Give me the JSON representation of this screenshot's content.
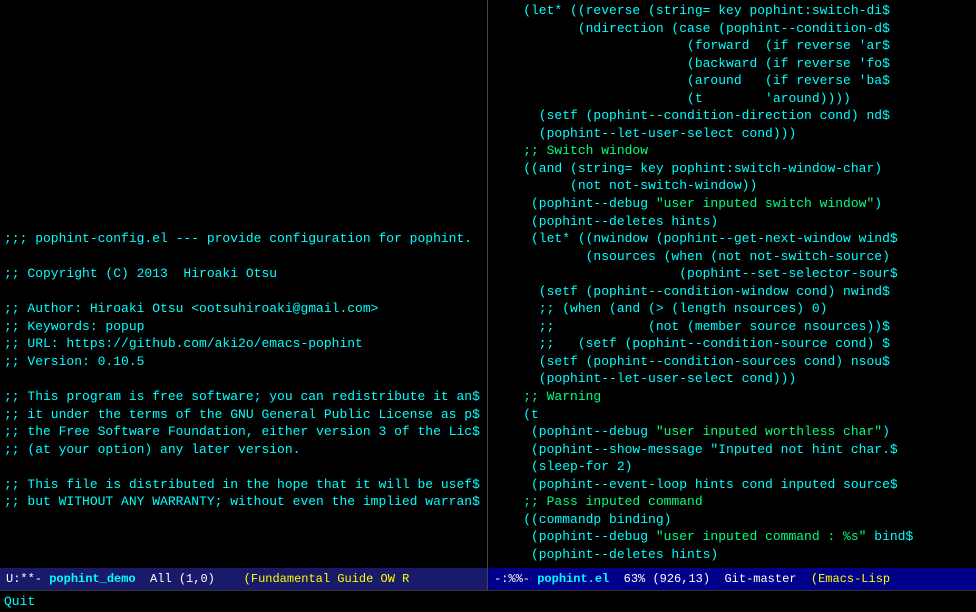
{
  "left_pane": {
    "content_lines": [
      "",
      "",
      "",
      "",
      "",
      "",
      "",
      "",
      "",
      "",
      "",
      "",
      "",
      ";;; pophint-config.el --- provide configuration for pophint.",
      "",
      ";; Copyright (C) 2013  Hiroaki Otsu",
      "",
      ";; Author: Hiroaki Otsu <ootsuhiroaki@gmail.com>",
      ";; Keywords: popup",
      ";; URL: https://github.com/aki2o/emacs-pophint",
      ";; Version: 0.10.5",
      "",
      ";; This program is free software; you can redistribute it an$",
      ";; it under the terms of the GNU General Public License as p$",
      ";; the Free Software Foundation, either version 3 of the Lic$",
      ";; (at your option) any later version.",
      "",
      ";; This file is distributed in the hope that it will be usef$",
      ";; but WITHOUT ANY WARRANTY; without even the implied warran$"
    ],
    "mode_line": {
      "flag": "U:**-",
      "filename": "pophint_demo",
      "position": "All (1,0)",
      "mode": "(Fundamental Guide OW R"
    }
  },
  "right_pane": {
    "content_lines": [
      "    (let* ((reverse (string= key pophint:switch-di$",
      "           (ndirection (case (pophint--condition-d$",
      "                         (forward  (if reverse 'ar$",
      "                         (backward (if reverse 'fo$",
      "                         (around   (if reverse 'ba$",
      "                         (t        'around))))",
      "      (setf (pophint--condition-direction cond) nd$",
      "      (pophint--let-user-select cond)))",
      "    ;; Switch window",
      "    ((and (string= key pophint:switch-window-char)",
      "          (not not-switch-window))",
      "     (pophint--debug \"user inputed switch window\")",
      "     (pophint--deletes hints)",
      "     (let* ((nwindow (pophint--get-next-window wind$",
      "            (nsources (when (not not-switch-source)",
      "                        (pophint--set-selector-sour$",
      "      (setf (pophint--condition-window cond) nwind$",
      "      ;; (when (and (> (length nsources) 0)",
      "      ;;            (not (member source nsources))$",
      "      ;;   (setf (pophint--condition-source cond) $",
      "      (setf (pophint--condition-sources cond) nsou$",
      "      (pophint--let-user-select cond)))",
      "    ;; Warning",
      "    (t",
      "     (pophint--debug \"user inputed worthless char\")",
      "     (pophint--show-message \"Inputed not hint char.$",
      "     (sleep-for 2)",
      "     (pophint--event-loop hints cond inputed source$",
      "    ;; Pass inputed command",
      "    ((commandp binding)",
      "     (pophint--debug \"user inputed command : %s\" bind$",
      "     (pophint--deletes hints)"
    ],
    "mode_line": {
      "flag": "-:%%- ",
      "filename": "pophint.el",
      "percentage": "63% (926,13)",
      "branch": "Git-master",
      "mode": "(Emacs-Lisp"
    }
  },
  "minibuffer": {
    "text": "Quit"
  }
}
